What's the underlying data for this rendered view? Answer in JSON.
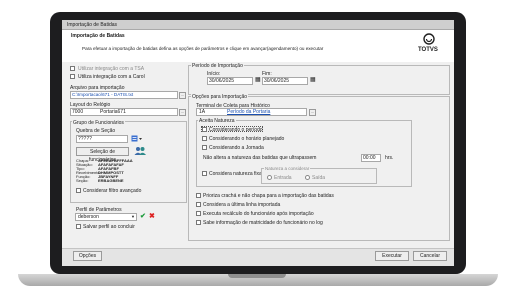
{
  "window_title": "Importação de Batidas",
  "header": {
    "title": "Importação de Batidas",
    "description": "Para efetuar a importação de batidas defina as opções de parâmetros e clique em avançar(agendamento) ou executar",
    "brand": "TOTVS"
  },
  "left": {
    "tsa_label": "Utilizar integração com a TSA",
    "carol_label": "Utiliza integração com a Carol",
    "arquivo_label": "Arquivo para importação",
    "arquivo_value": "C:\\Importacao\\671 - DATIS.txt",
    "layout_label": "Layout do Relógio",
    "layout_code": "7000",
    "layout_name": "Portaria671",
    "grupo_label": "Grupo de Funcionários",
    "quebra_label": "Quebra de Seção",
    "quebra_value": "?????",
    "selecao_button": "Seleção de funcionários",
    "info_labels": [
      "Chapa:",
      "Situação:",
      "Tipo:",
      "Recebimento:",
      "Função:",
      "Seção:"
    ],
    "info_values": [
      "AFEEAFBFFFAAA",
      "AFAFAFAFAF",
      "AFAFAFBF",
      "DHMMPOSTT",
      "JBFAYNFF",
      "ERBAGBENE"
    ],
    "consider_label": "Considerar filtro avançado",
    "perfil_label": "Perfil de Parâmetros",
    "perfil_value": "deberson",
    "salvar_label": "Salvar perfil ao concluir"
  },
  "right": {
    "periodo_label": "Período de Importação",
    "inicio_label": "Início:",
    "inicio_value": "30/06/2025",
    "fim_label": "Fim:",
    "fim_value": "30/06/2025",
    "opcoes_label": "Opções para Importação",
    "terminal_label": "Terminal de Coleta para Histórico",
    "terminal_code": "1A",
    "terminal_name": "Período da Portaria",
    "aceita_label": "Aceita Natureza",
    "aceita_options": [
      "Considerando o período",
      "Considerando o horário planejado",
      "Considerando a Jornada"
    ],
    "nao_altera_label": "Não altera a natureza das batidas que ultrapassem",
    "nao_altera_value": "00:00",
    "nao_altera_unit": "hrs.",
    "considera_nat_label": "Considera natureza fixa",
    "natureza_group": "Natureza a considerar",
    "entrada": "Entrada",
    "saida": "Saída",
    "checks": [
      "Prioriza crachá e não chapa para a importação das batidas",
      "Considera a última linha importada",
      "Executa recálculo do funcionário após importação",
      "Sabe informação de matricidade do funcionário no log"
    ]
  },
  "footer": {
    "opcoes": "Opções",
    "executar": "Executar",
    "cancelar": "Cancelar"
  }
}
